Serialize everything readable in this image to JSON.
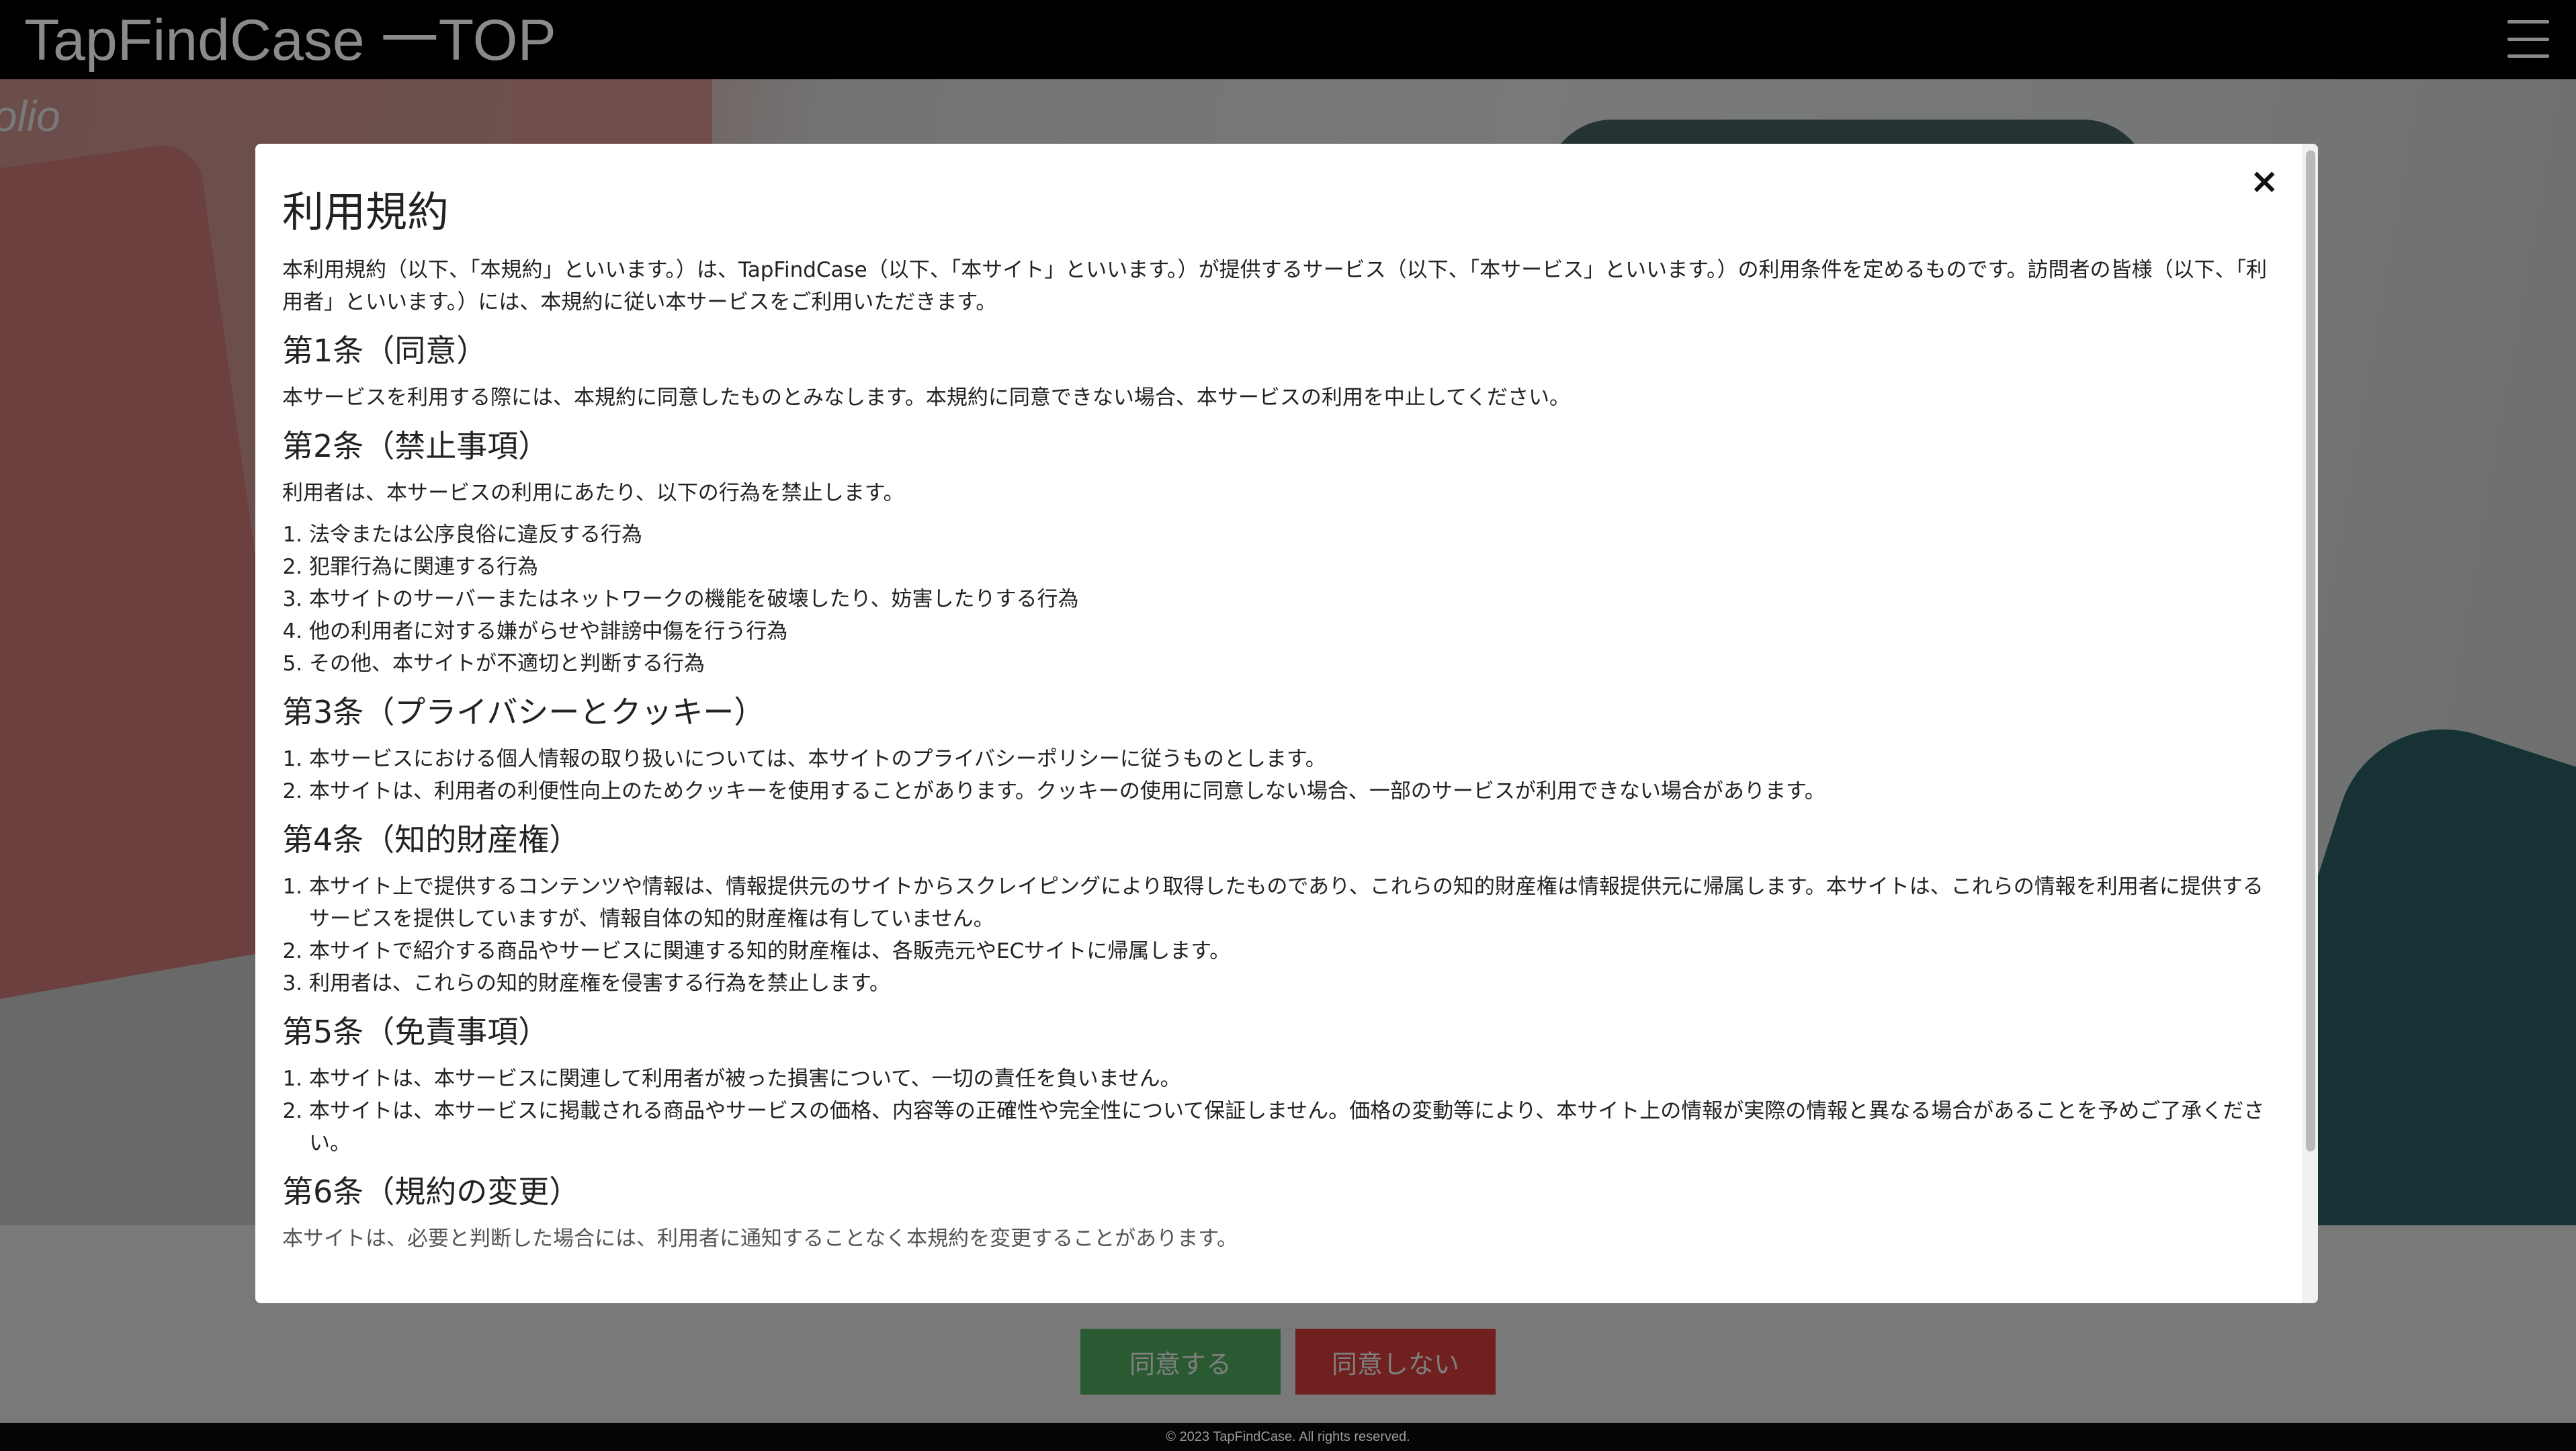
{
  "header": {
    "site_title": "TapFindCase 一TOP"
  },
  "hero": {
    "watermark": "olio"
  },
  "modal": {
    "title": "利用規約",
    "close_label": "×",
    "intro": "本利用規約（以下、「本規約」といいます。）は、TapFindCase（以下、「本サイト」といいます。）が提供するサービス（以下、「本サービス」といいます。）の利用条件を定めるものです。訪問者の皆様（以下、「利用者」といいます。）には、本規約に従い本サービスをご利用いただきます。",
    "sections": [
      {
        "heading": "第1条（同意）",
        "text": "本サービスを利用する際には、本規約に同意したものとみなします。本規約に同意できない場合、本サービスの利用を中止してください。"
      },
      {
        "heading": "第2条（禁止事項）",
        "text": "利用者は、本サービスの利用にあたり、以下の行為を禁止します。",
        "items": [
          "法令または公序良俗に違反する行為",
          "犯罪行為に関連する行為",
          "本サイトのサーバーまたはネットワークの機能を破壊したり、妨害したりする行為",
          "他の利用者に対する嫌がらせや誹謗中傷を行う行為",
          "その他、本サイトが不適切と判断する行為"
        ]
      },
      {
        "heading": "第3条（プライバシーとクッキー）",
        "items": [
          "本サービスにおける個人情報の取り扱いについては、本サイトのプライバシーポリシーに従うものとします。",
          "本サイトは、利用者の利便性向上のためクッキーを使用することがあります。クッキーの使用に同意しない場合、一部のサービスが利用できない場合があります。"
        ]
      },
      {
        "heading": "第4条（知的財産権）",
        "items": [
          "本サイト上で提供するコンテンツや情報は、情報提供元のサイトからスクレイピングにより取得したものであり、これらの知的財産権は情報提供元に帰属します。本サイトは、これらの情報を利用者に提供するサービスを提供していますが、情報自体の知的財産権は有していません。",
          "本サイトで紹介する商品やサービスに関連する知的財産権は、各販売元やECサイトに帰属します。",
          "利用者は、これらの知的財産権を侵害する行為を禁止します。"
        ]
      },
      {
        "heading": "第5条（免責事項）",
        "items": [
          "本サイトは、本サービスに関連して利用者が被った損害について、一切の責任を負いません。",
          "本サイトは、本サービスに掲載される商品やサービスの価格、内容等の正確性や完全性について保証しません。価格の変動等により、本サイト上の情報が実際の情報と異なる場合があることを予めご了承ください。"
        ]
      },
      {
        "heading": "第6条（規約の変更）",
        "partial_text": "本サイトは、必要と判断した場合には、利用者に通知することなく本規約を変更することがあります。"
      }
    ]
  },
  "actions": {
    "agree_label": "同意する",
    "disagree_label": "同意しない"
  },
  "footer": {
    "copyright": "© 2023 TapFindCase. All rights reserved."
  }
}
